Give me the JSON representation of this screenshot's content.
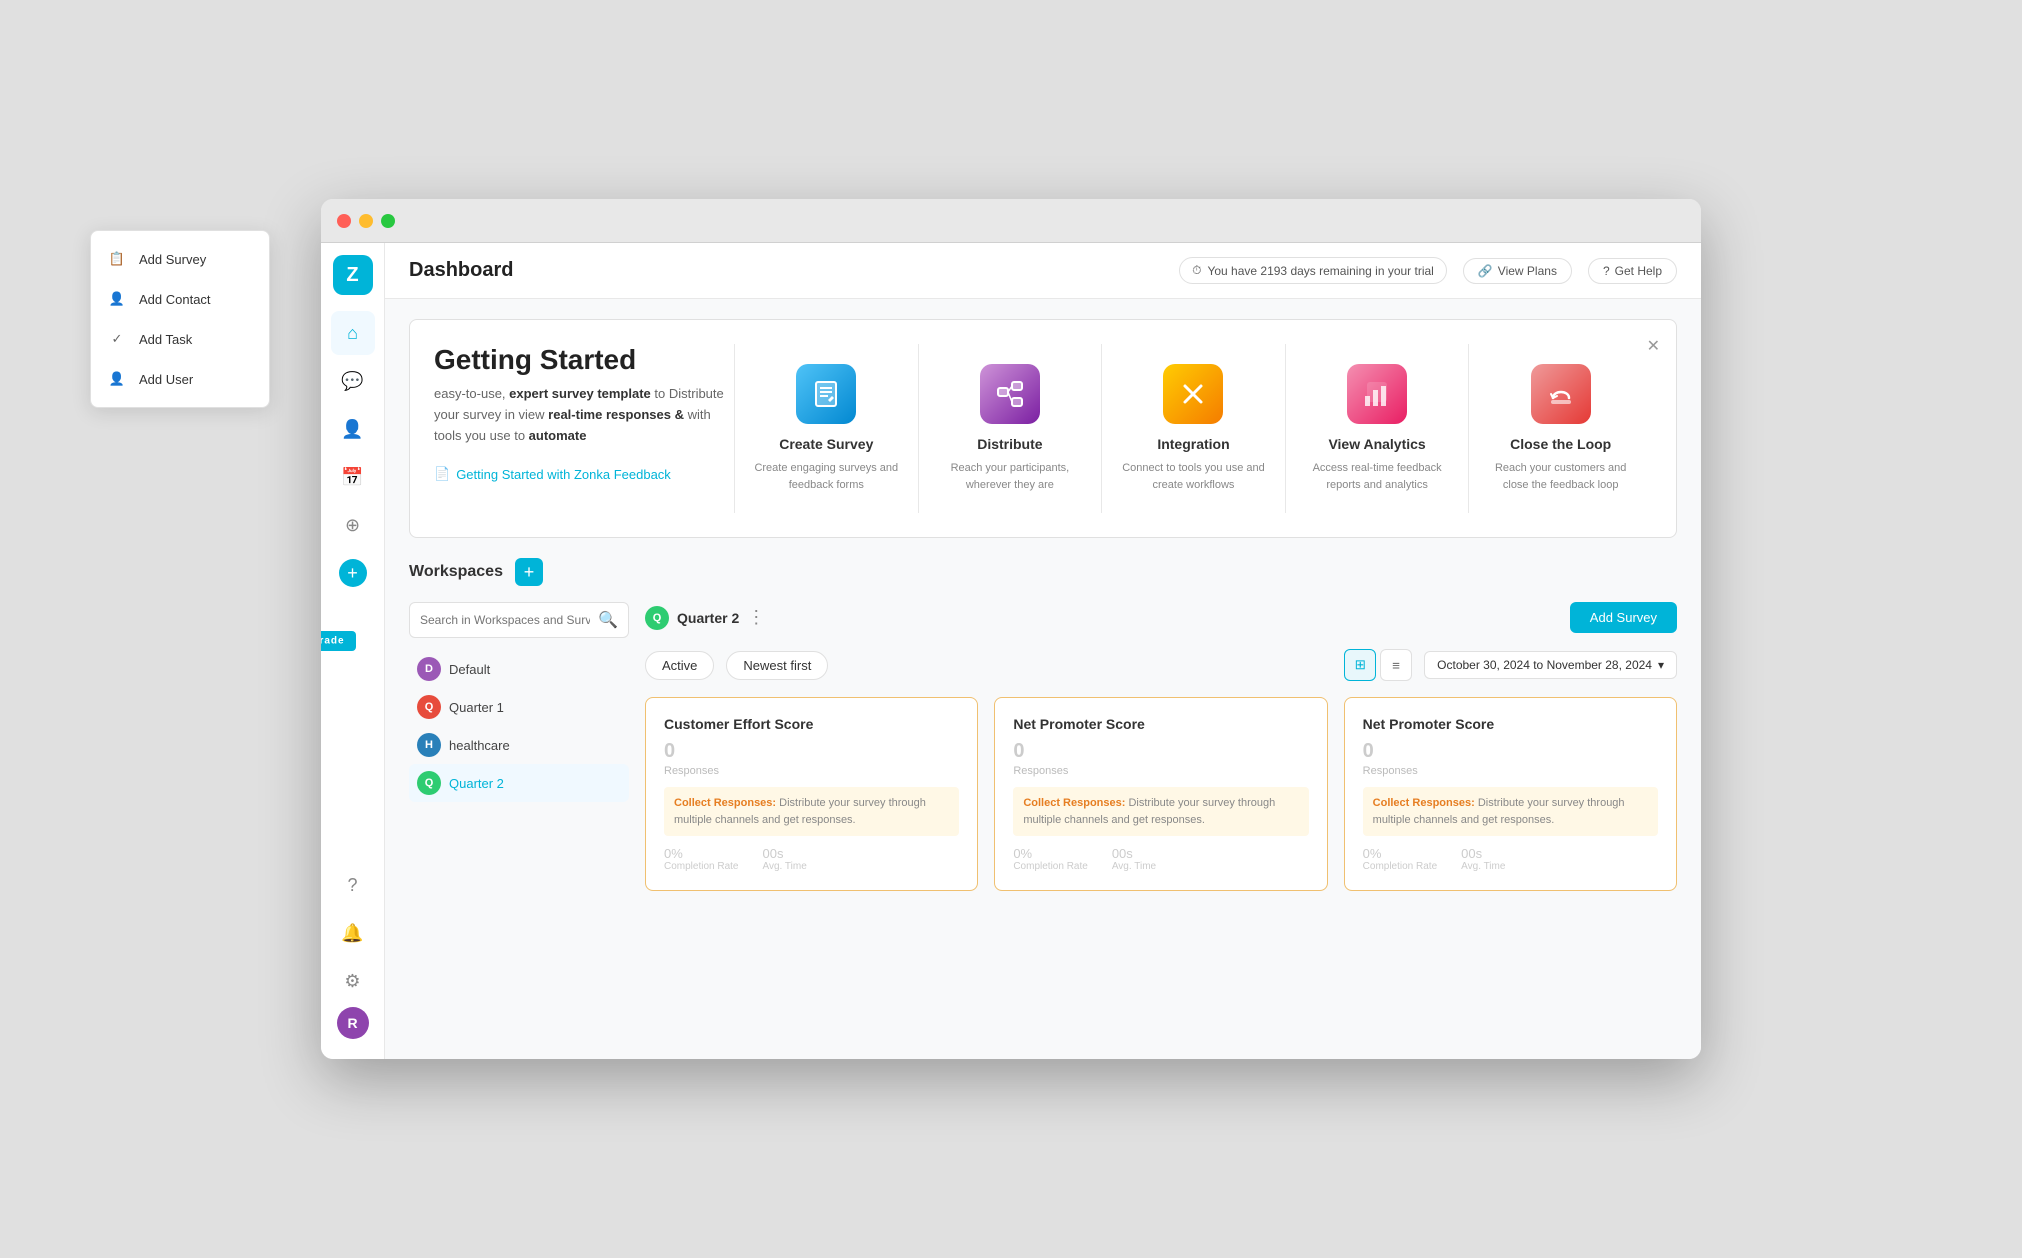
{
  "window": {
    "title": "Dashboard"
  },
  "header": {
    "title": "Dashboard",
    "trial_text": "You have 2193 days remaining in your trial",
    "view_plans": "View Plans",
    "get_help": "Get Help"
  },
  "sidebar": {
    "logo": "Z",
    "upgrade": "Upgrade",
    "avatar": "R",
    "nav_items": [
      {
        "id": "home",
        "icon": "⌂",
        "active": true
      },
      {
        "id": "chat",
        "icon": "💬"
      },
      {
        "id": "contacts",
        "icon": "👤"
      },
      {
        "id": "tasks",
        "icon": "📅"
      },
      {
        "id": "settings2",
        "icon": "⚙"
      }
    ],
    "bottom_items": [
      {
        "id": "help",
        "icon": "?"
      },
      {
        "id": "bell",
        "icon": "🔔"
      },
      {
        "id": "settings",
        "icon": "⚙"
      }
    ]
  },
  "dropdown": {
    "items": [
      {
        "id": "add-survey",
        "label": "Add Survey",
        "icon": "📋"
      },
      {
        "id": "add-contact",
        "label": "Add Contact",
        "icon": "👤"
      },
      {
        "id": "add-task",
        "label": "Add Task",
        "icon": "✓"
      },
      {
        "id": "add-user",
        "label": "Add User",
        "icon": "👤"
      }
    ]
  },
  "getting_started": {
    "title": "Getting Started",
    "description_parts": [
      "easy-to-use,",
      " expert survey template",
      " to Distribute your survey in view ",
      "real-time responses &",
      " with tools you use to ",
      "automate"
    ],
    "link_text": "Getting Started with Zonka Feedback",
    "cards": [
      {
        "id": "create-survey",
        "title": "Create Survey",
        "description": "Create engaging surveys and feedback forms",
        "icon": "✦",
        "icon_class": "icon-create"
      },
      {
        "id": "distribute",
        "title": "Distribute",
        "description": "Reach your participants, wherever they are",
        "icon": "⊞",
        "icon_class": "icon-distribute"
      },
      {
        "id": "integration",
        "title": "Integration",
        "description": "Connect to tools you use and create workflows",
        "icon": "✕",
        "icon_class": "icon-integration"
      },
      {
        "id": "view-analytics",
        "title": "View Analytics",
        "description": "Access real-time feedback reports and analytics",
        "icon": "📊",
        "icon_class": "icon-analytics"
      },
      {
        "id": "close-loop",
        "title": "Close the Loop",
        "description": "Reach your customers and close the feedback loop",
        "icon": "↩",
        "icon_class": "icon-loop"
      }
    ]
  },
  "workspaces": {
    "title": "Workspaces",
    "search_placeholder": "Search in Workspaces and Surveys",
    "add_survey_label": "Add Survey",
    "items": [
      {
        "id": "default",
        "label": "Default",
        "color": "#9b59b6",
        "letter": "D"
      },
      {
        "id": "quarter1",
        "label": "Quarter 1",
        "color": "#e74c3c",
        "letter": "Q"
      },
      {
        "id": "healthcare",
        "label": "healthcare",
        "color": "#2980b9",
        "letter": "H"
      },
      {
        "id": "quarter2",
        "label": "Quarter 2",
        "color": "#2ecc71",
        "letter": "Q",
        "active": true
      }
    ],
    "active_workspace": {
      "name": "Quarter 2",
      "letter": "Q",
      "color": "#2ecc71"
    },
    "filters": {
      "active_label": "Active",
      "sort_label": "Newest first"
    },
    "date_range": "October 30, 2024 to November 28, 2024",
    "surveys": [
      {
        "id": "ces",
        "title": "Customer Effort Score",
        "responses": "0",
        "responses_label": "Responses",
        "collect_label": "Collect Responses:",
        "collect_text": " Distribute your survey through multiple channels and get responses.",
        "completion_rate_value": "0%",
        "completion_rate_label": "Completion Rate",
        "avg_time_value": "00s",
        "avg_time_label": "Avg. Time"
      },
      {
        "id": "nps1",
        "title": "Net Promoter Score",
        "responses": "0",
        "responses_label": "Responses",
        "collect_label": "Collect Responses:",
        "collect_text": " Distribute your survey through multiple channels and get responses.",
        "completion_rate_value": "0%",
        "completion_rate_label": "Completion Rate",
        "avg_time_value": "00s",
        "avg_time_label": "Avg. Time"
      },
      {
        "id": "nps2",
        "title": "Net Promoter Score",
        "responses": "0",
        "responses_label": "Responses",
        "collect_label": "Collect Responses:",
        "collect_text": " Distribute your survey through multiple channels and get responses.",
        "completion_rate_value": "0%",
        "completion_rate_label": "Completion Rate",
        "avg_time_value": "00s",
        "avg_time_label": "Avg. Time"
      }
    ]
  }
}
